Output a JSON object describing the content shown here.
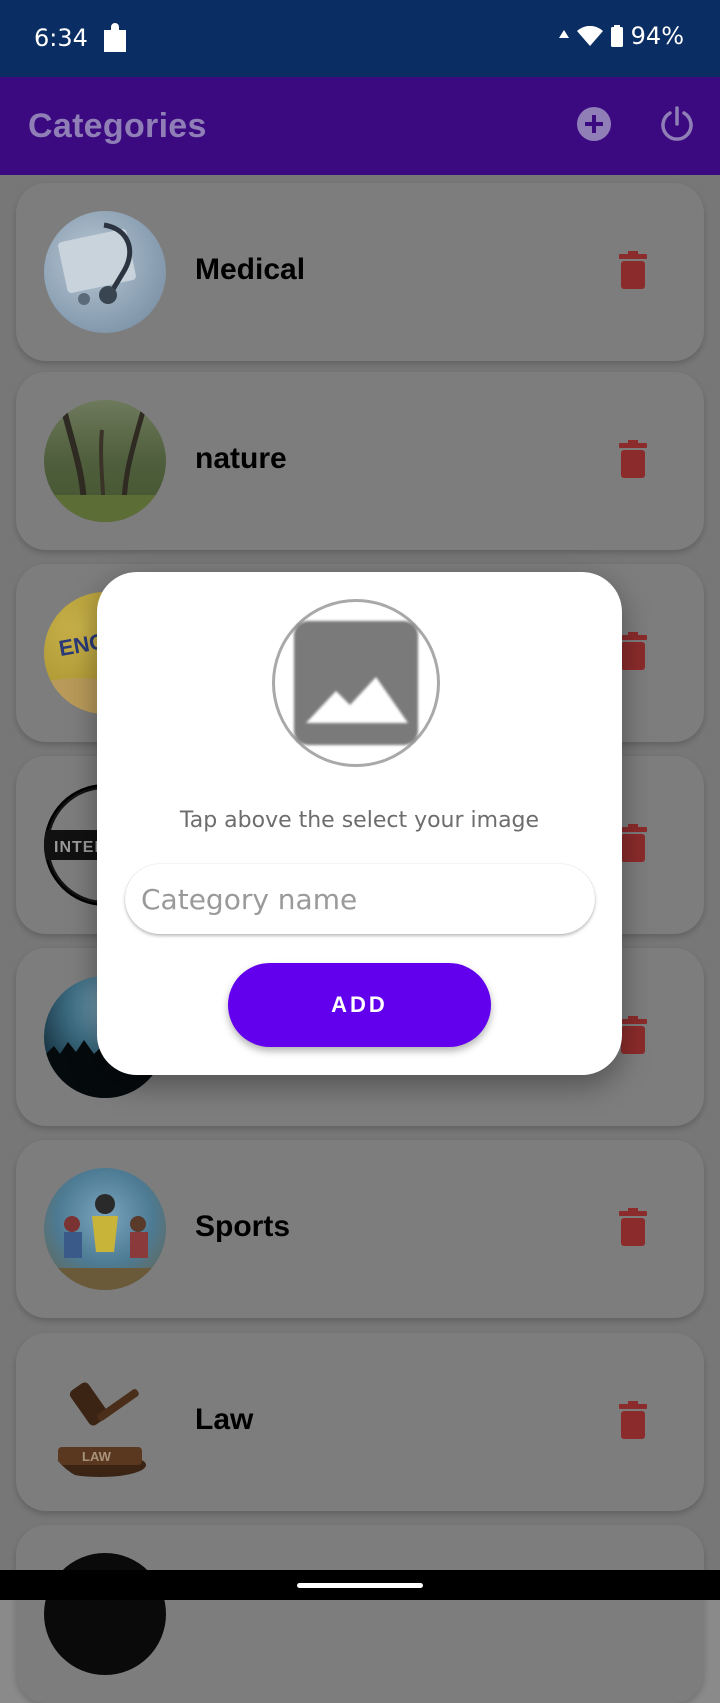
{
  "status_bar": {
    "time": "6:34",
    "battery": "94%"
  },
  "app_bar": {
    "title": "Categories",
    "add_icon": "add-circle-icon",
    "power_icon": "power-icon"
  },
  "categories": [
    {
      "label": "Medical",
      "has_label_visible": true
    },
    {
      "label": "nature",
      "has_label_visible": true
    },
    {
      "label": "",
      "thumb_text": "ENG"
    },
    {
      "label": "",
      "thumb_text": "INTER"
    },
    {
      "label": ""
    },
    {
      "label": "Sports",
      "has_label_visible": true
    },
    {
      "label": "Law",
      "has_label_visible": true,
      "thumb_text": "LAW"
    },
    {
      "label": ""
    }
  ],
  "dialog": {
    "hint": "Tap above the select your image",
    "name_placeholder": "Category name",
    "name_value": "",
    "add_label": "ADD"
  },
  "colors": {
    "status_bar": "#0a2d63",
    "app_bar": "#3b0a80",
    "accent": "#6200ee",
    "trash": "#8b2b2b"
  }
}
